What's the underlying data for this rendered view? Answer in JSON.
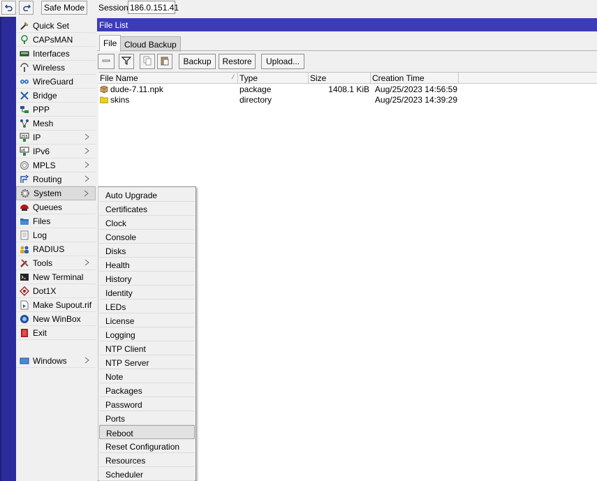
{
  "topbar": {
    "undo_icon": "undo-icon",
    "redo_icon": "redo-icon",
    "safe_mode_label": "Safe Mode",
    "session_label": "Session:",
    "session_value": "186.0.151.41"
  },
  "sidebar": {
    "items": [
      {
        "label": "Quick Set",
        "icon": "quick-set-icon",
        "arrow": false
      },
      {
        "label": "CAPsMAN",
        "icon": "capsman-icon",
        "arrow": false
      },
      {
        "label": "Interfaces",
        "icon": "interfaces-icon",
        "arrow": false
      },
      {
        "label": "Wireless",
        "icon": "wireless-icon",
        "arrow": false
      },
      {
        "label": "WireGuard",
        "icon": "wireguard-icon",
        "arrow": false
      },
      {
        "label": "Bridge",
        "icon": "bridge-icon",
        "arrow": false
      },
      {
        "label": "PPP",
        "icon": "ppp-icon",
        "arrow": false
      },
      {
        "label": "Mesh",
        "icon": "mesh-icon",
        "arrow": false
      },
      {
        "label": "IP",
        "icon": "ip-icon",
        "arrow": true
      },
      {
        "label": "IPv6",
        "icon": "ipv6-icon",
        "arrow": true
      },
      {
        "label": "MPLS",
        "icon": "mpls-icon",
        "arrow": true
      },
      {
        "label": "Routing",
        "icon": "routing-icon",
        "arrow": true
      },
      {
        "label": "System",
        "icon": "system-icon",
        "arrow": true
      },
      {
        "label": "Queues",
        "icon": "queues-icon",
        "arrow": false
      },
      {
        "label": "Files",
        "icon": "files-icon",
        "arrow": false
      },
      {
        "label": "Log",
        "icon": "log-icon",
        "arrow": false
      },
      {
        "label": "RADIUS",
        "icon": "radius-icon",
        "arrow": false
      },
      {
        "label": "Tools",
        "icon": "tools-icon",
        "arrow": true
      },
      {
        "label": "New Terminal",
        "icon": "terminal-icon",
        "arrow": false
      },
      {
        "label": "Dot1X",
        "icon": "dot1x-icon",
        "arrow": false
      },
      {
        "label": "Make Supout.rif",
        "icon": "supout-icon",
        "arrow": false
      },
      {
        "label": "New WinBox",
        "icon": "winbox-icon",
        "arrow": false
      },
      {
        "label": "Exit",
        "icon": "exit-icon",
        "arrow": false
      },
      {
        "label": "Windows",
        "icon": "windows-icon",
        "arrow": true
      }
    ]
  },
  "window": {
    "title": "File List",
    "tabs": [
      "File",
      "Cloud Backup"
    ],
    "toolbar": {
      "backup_label": "Backup",
      "restore_label": "Restore",
      "upload_label": "Upload..."
    },
    "columns": [
      "File Name",
      "Type",
      "Size",
      "Creation Time"
    ],
    "rows": [
      {
        "name": "dude-7.11.npk",
        "type": "package",
        "size": "1408.1 KiB",
        "created": "Aug/25/2023 14:56:59",
        "icon": "package-icon"
      },
      {
        "name": "skins",
        "type": "directory",
        "size": "",
        "created": "Aug/25/2023 14:39:29",
        "icon": "folder-icon"
      }
    ]
  },
  "system_menu": {
    "items": [
      "Auto Upgrade",
      "Certificates",
      "Clock",
      "Console",
      "Disks",
      "Health",
      "History",
      "Identity",
      "LEDs",
      "License",
      "Logging",
      "NTP Client",
      "NTP Server",
      "Note",
      "Packages",
      "Password",
      "Ports",
      "Reboot",
      "Reset Configuration",
      "Resources",
      "Scheduler"
    ],
    "hovered": "Reboot"
  },
  "colors": {
    "title_bar": "#3c3cb8",
    "nav_strip": "#2b2b9b",
    "background": "#f0f0f0"
  }
}
